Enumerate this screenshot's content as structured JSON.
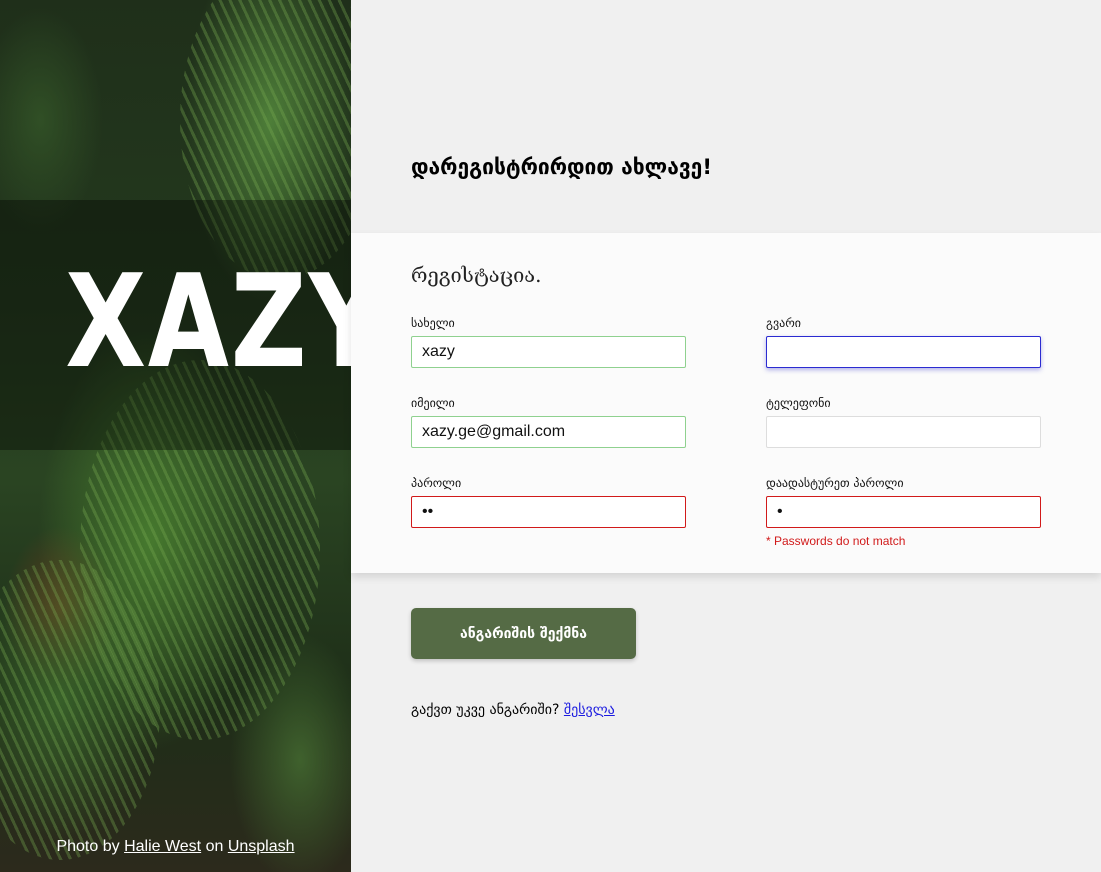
{
  "hero": {
    "logo_text": "XAZY",
    "credit_prefix": "Photo by",
    "credit_author": "Halie West",
    "credit_middle": "on",
    "credit_site": "Unsplash"
  },
  "page": {
    "heading": "დარეგისტრირდით ახლავე!"
  },
  "form": {
    "title": "რეგისტაცია.",
    "first_name": {
      "label": "სახელი",
      "value": "xazy"
    },
    "last_name": {
      "label": "გვარი",
      "value": ""
    },
    "email": {
      "label": "იმეილი",
      "value": "xazy.ge@gmail.com"
    },
    "phone": {
      "label": "ტელეფონი",
      "value": ""
    },
    "password": {
      "label": "პაროლი",
      "value": "ab"
    },
    "confirm_password": {
      "label": "დაადასტურეთ პაროლი",
      "value": "a"
    },
    "error": "* Passwords do not match",
    "submit_label": "ანგარიშის შექმნა"
  },
  "login": {
    "prompt": "გაქვთ უკვე ანგარიში?",
    "link_label": "შესვლა"
  },
  "colors": {
    "button": "#556b45",
    "valid_border": "#8fd18f",
    "error": "#d11a1a",
    "focus_border": "#2b2bd1",
    "link": "#1a1ae0"
  }
}
